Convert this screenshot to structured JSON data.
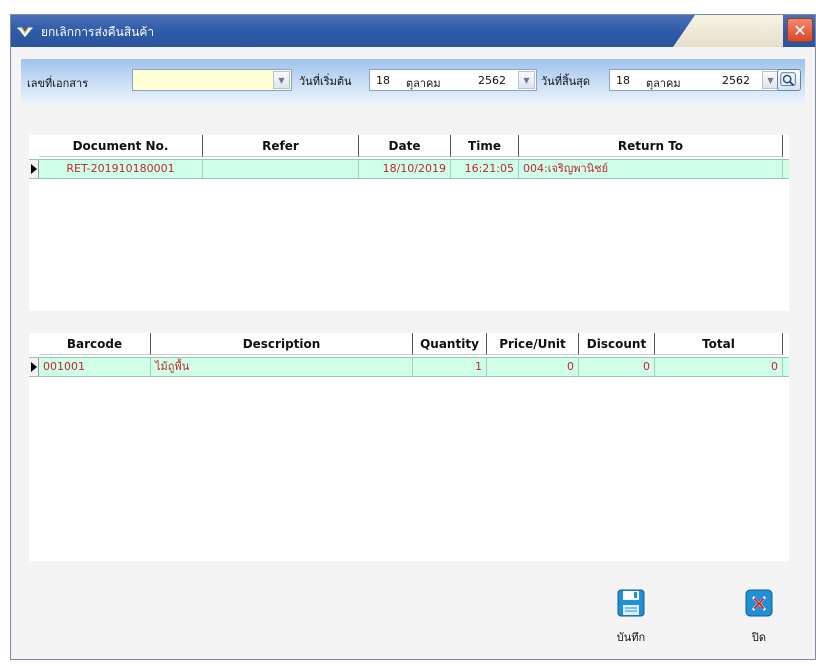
{
  "window": {
    "title": "ยกเลิกการส่งคืนสินค้า",
    "close_label": "✕"
  },
  "filters": {
    "doc_label": "เลขที่เอกสาร",
    "doc_value": "",
    "start_label": "วันที่เริ่มต้น",
    "start_date": {
      "day": "18",
      "month": "ตุลาคม",
      "year": "2562"
    },
    "end_label": "วันที่สิ้นสุด",
    "end_date": {
      "day": "18",
      "month": "ตุลาคม",
      "year": "2562"
    }
  },
  "documents": {
    "columns": [
      "Document No.",
      "Refer",
      "Date",
      "Time",
      "Return To"
    ],
    "rows": [
      {
        "doc_no": "RET-201910180001",
        "refer": "",
        "date": "18/10/2019",
        "time": "16:21:05",
        "return_to": "004:เจริญพานิชย์"
      }
    ]
  },
  "items": {
    "columns": [
      "Barcode",
      "Description",
      "Quantity",
      "Price/Unit",
      "Discount",
      "Total"
    ],
    "rows": [
      {
        "barcode": "001001",
        "description": "ไม้ถูพื้น",
        "quantity": "1",
        "price": "0",
        "discount": "0",
        "total": "0"
      }
    ]
  },
  "actions": {
    "save_label": "บันทึก",
    "close_label": "ปิด"
  },
  "colors": {
    "title_bar": "#2d5aa8",
    "selected_row": "#cfffe8",
    "row_text": "#c0282d"
  }
}
